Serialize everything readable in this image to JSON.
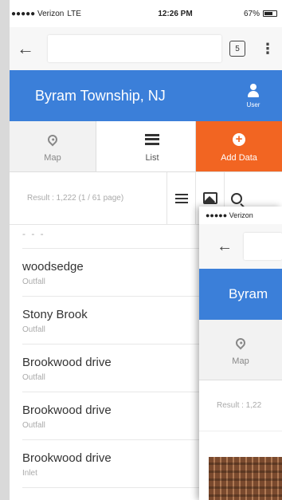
{
  "status": {
    "carrier": "●●●●● Verizon",
    "network": "LTE",
    "time": "12:26 PM",
    "battery": "67%"
  },
  "browser": {
    "tabs_count": "5",
    "url_value": ""
  },
  "app": {
    "title": "Byram Township, NJ",
    "user_label": "User"
  },
  "nav": {
    "map": "Map",
    "list": "List",
    "add": "Add Data"
  },
  "result": {
    "text": "Result : 1,222 (1 / 61 page)"
  },
  "items": [
    {
      "title": "woodsedge",
      "sub": "Outfall"
    },
    {
      "title": "Stony Brook",
      "sub": "Outfall"
    },
    {
      "title": "Brookwood drive",
      "sub": "Outfall"
    },
    {
      "title": "Brookwood drive",
      "sub": "Outfall"
    },
    {
      "title": "Brookwood drive",
      "sub": "Inlet"
    }
  ],
  "partial_item": "- - -",
  "front": {
    "carrier": "●●●●● Verizon",
    "title": "Byram",
    "map": "Map",
    "result": "Result : 1,22"
  },
  "colors": {
    "primary": "#3b7fd9",
    "accent": "#f26522"
  }
}
